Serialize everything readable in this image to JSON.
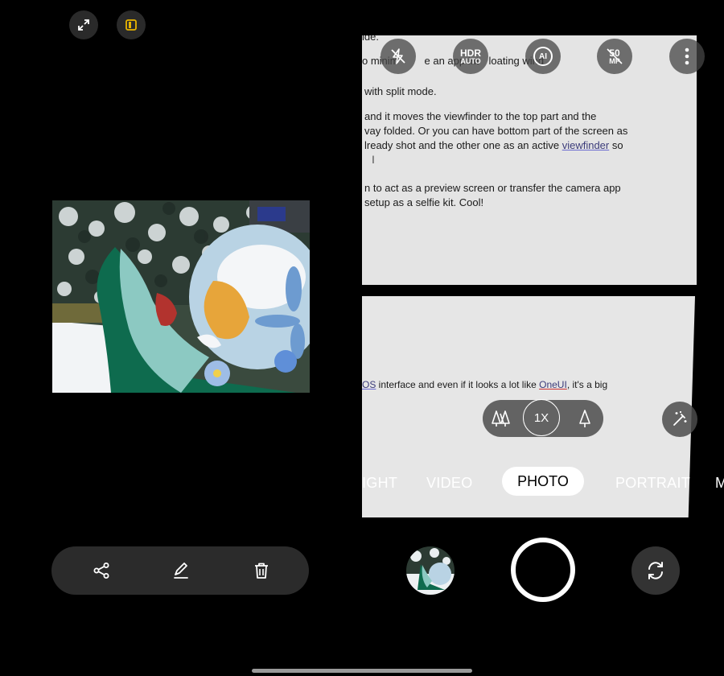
{
  "top_left": {
    "expand_icon": "expand-icon",
    "layout_icon": "panel-layout-icon",
    "layout_accent": "#e8b400"
  },
  "gallery_actions": {
    "share_icon": "share-icon",
    "edit_icon": "edit-icon",
    "delete_icon": "trash-icon"
  },
  "top_controls": {
    "flash_icon": "flash-off-icon",
    "hdr_label": "HDR",
    "hdr_sub": "AUTO",
    "ai_label": "AI",
    "mp_label": "50",
    "mp_sub": "MP",
    "more_icon": "more-vertical-icon"
  },
  "document_text": {
    "line1": "ide.",
    "line2a": "o minim",
    "line2b": "e an app int",
    "line2c": "loating wind",
    "line3": "with split mode.",
    "line4": "and it moves the viewfinder to the top part and the",
    "line5": "vay folded. Or you can have bottom part of the screen as",
    "line6a": "lready shot and the other one as an active ",
    "line6b": "viewfinder",
    "line6c": " so",
    "line7": "n to act as a preview screen or transfer the camera app",
    "line8": "setup as a selfie kit. Cool!",
    "line9a": "OS",
    "line9b": " interface and even if it looks a lot like ",
    "line9c": "OneUI",
    "line9d": ", it's a big"
  },
  "zoom": {
    "current": "1X",
    "wide_icon": "trees-wide-icon",
    "tele_icon": "tree-tele-icon"
  },
  "effects_icon": "magic-wand-icon",
  "modes": {
    "night": "IGHT",
    "video": "VIDEO",
    "photo": "PHOTO",
    "portrait": "PORTRAIT",
    "more": "M"
  },
  "bottom_controls": {
    "thumbnail_icon": "last-photo-thumbnail",
    "shutter": "shutter-button",
    "flip_icon": "flip-camera-icon"
  }
}
